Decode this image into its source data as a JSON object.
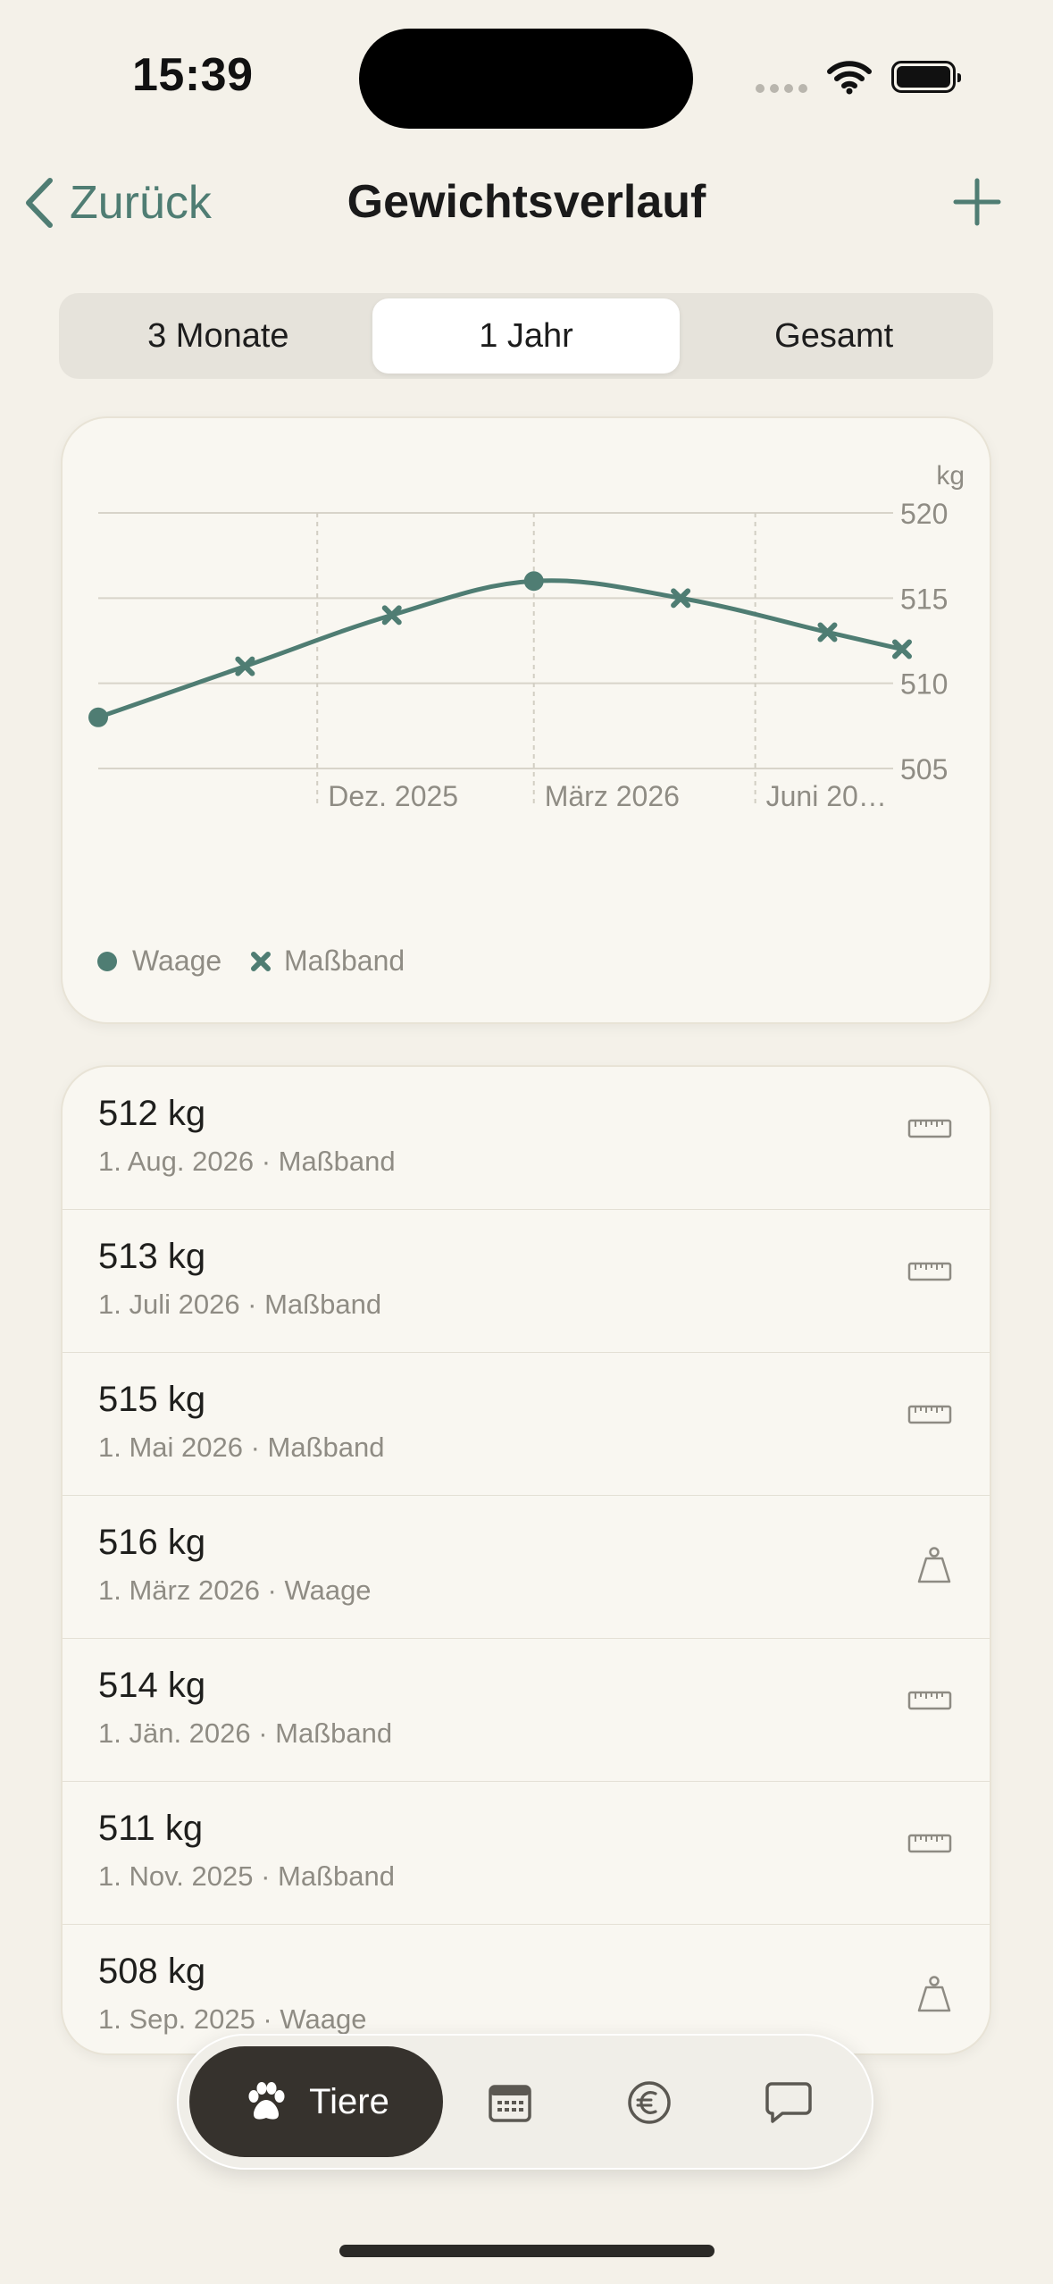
{
  "status": {
    "time": "15:39"
  },
  "nav": {
    "back_label": "Zurück",
    "title": "Gewichtsverlauf"
  },
  "segments": [
    {
      "label": "3 Monate",
      "active": false
    },
    {
      "label": "1 Jahr",
      "active": true
    },
    {
      "label": "Gesamt",
      "active": false
    }
  ],
  "chart_data": {
    "type": "line",
    "unit_label": "kg",
    "ylim": [
      505,
      520
    ],
    "y_ticks": [
      505,
      510,
      515,
      520
    ],
    "x_tick_labels": [
      "Dez. 2025",
      "März 2026",
      "Juni 20…"
    ],
    "grid": true,
    "legend": [
      {
        "name": "Waage",
        "marker": "circle"
      },
      {
        "name": "Maßband",
        "marker": "cross"
      }
    ],
    "color": "#4f7d73",
    "points": [
      {
        "x": "2025-09-01",
        "y": 508,
        "method": "Waage"
      },
      {
        "x": "2025-11-01",
        "y": 511,
        "method": "Maßband"
      },
      {
        "x": "2026-01-01",
        "y": 514,
        "method": "Maßband"
      },
      {
        "x": "2026-03-01",
        "y": 516,
        "method": "Waage"
      },
      {
        "x": "2026-05-01",
        "y": 515,
        "method": "Maßband"
      },
      {
        "x": "2026-07-01",
        "y": 513,
        "method": "Maßband"
      },
      {
        "x": "2026-08-01",
        "y": 512,
        "method": "Maßband"
      }
    ]
  },
  "entries": [
    {
      "weight": "512 kg",
      "detail": "1. Aug. 2026 · Maßband",
      "icon": "ruler-icon"
    },
    {
      "weight": "513 kg",
      "detail": "1. Juli 2026 · Maßband",
      "icon": "ruler-icon"
    },
    {
      "weight": "515 kg",
      "detail": "1. Mai 2026 · Maßband",
      "icon": "ruler-icon"
    },
    {
      "weight": "516 kg",
      "detail": "1. März 2026 · Waage",
      "icon": "scale-weight-icon"
    },
    {
      "weight": "514 kg",
      "detail": "1. Jän. 2026 · Maßband",
      "icon": "ruler-icon"
    },
    {
      "weight": "511 kg",
      "detail": "1. Nov. 2025 · Maßband",
      "icon": "ruler-icon"
    },
    {
      "weight": "508 kg",
      "detail": "1. Sep. 2025 · Waage",
      "icon": "scale-weight-icon"
    }
  ],
  "tabbar": {
    "active_label": "Tiere",
    "tabs": [
      "paw-icon",
      "calendar-icon",
      "euro-icon",
      "chat-bubble-icon"
    ]
  },
  "colors": {
    "accent": "#4f7d73",
    "background": "#f4f1e9",
    "card": "#f9f7f1",
    "tab_active": "#36322d"
  }
}
